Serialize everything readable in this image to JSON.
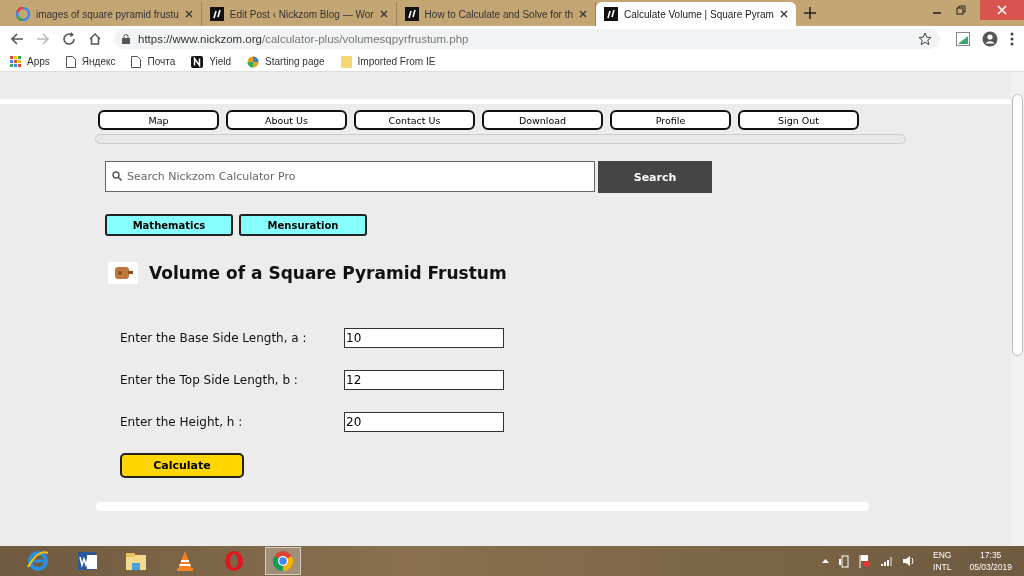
{
  "tabs": [
    {
      "title": "images of square pyramid frustu",
      "kind": "google",
      "selected": false
    },
    {
      "title": "Edit Post ‹ Nickzom Blog — Wor",
      "kind": "nickzom",
      "selected": false
    },
    {
      "title": "How to Calculate and Solve for th",
      "kind": "nickzom",
      "selected": false
    },
    {
      "title": "Calculate Volume | Square Pyram",
      "kind": "nickzom",
      "selected": true
    }
  ],
  "address": {
    "host": "https://www.nickzom.org",
    "path": "/calculator-plus/volumesqpyrfrustum.php"
  },
  "bookmarks": [
    {
      "label": "Apps",
      "kind": "apps"
    },
    {
      "label": "Яндекс",
      "kind": "page"
    },
    {
      "label": "Почта",
      "kind": "page"
    },
    {
      "label": "Yield",
      "kind": "n"
    },
    {
      "label": "Starting page",
      "kind": "globe"
    },
    {
      "label": "Imported From IE",
      "kind": "folder"
    }
  ],
  "nav": [
    "Map",
    "About Us",
    "Contact Us",
    "Download",
    "Profile",
    "Sign Out"
  ],
  "search": {
    "placeholder": "Search Nickzom Calculator Pro",
    "button": "Search"
  },
  "categories": [
    "Mathematics",
    "Mensuration"
  ],
  "heading": "Volume of a Square Pyramid Frustum",
  "fields": [
    {
      "label": "Enter the Base Side Length, a :",
      "value": "10"
    },
    {
      "label": "Enter the Top Side Length, b :",
      "value": "12"
    },
    {
      "label": "Enter the Height, h :",
      "value": "20"
    }
  ],
  "calculate": "Calculate",
  "taskbar": {
    "apps": [
      {
        "kind": "ie",
        "selected": false
      },
      {
        "kind": "word",
        "selected": false
      },
      {
        "kind": "explorer",
        "selected": false
      },
      {
        "kind": "vlc",
        "selected": false
      },
      {
        "kind": "opera",
        "selected": false
      },
      {
        "kind": "chrome",
        "selected": true
      }
    ],
    "language": [
      "ENG",
      "INTL"
    ],
    "time": "17:35",
    "date": "05/03/2019"
  }
}
